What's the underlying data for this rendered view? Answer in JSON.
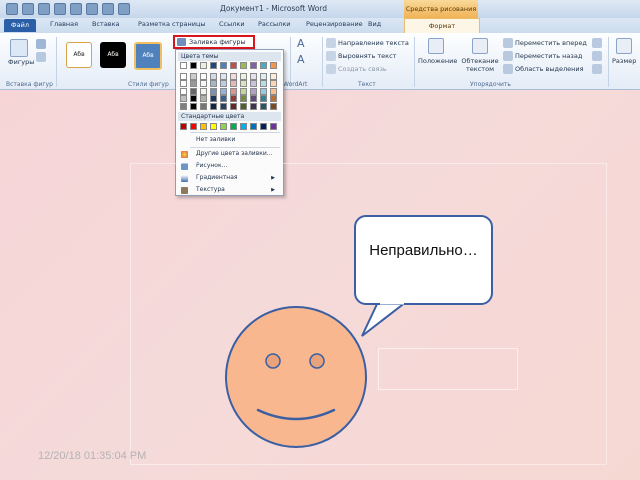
{
  "window": {
    "title": "Документ1 - Microsoft Word",
    "context_tab_header": "Средства рисования"
  },
  "tabs": [
    {
      "label": "Файл"
    },
    {
      "label": "Главная"
    },
    {
      "label": "Вставка"
    },
    {
      "label": "Разметка страницы"
    },
    {
      "label": "Ссылки"
    },
    {
      "label": "Рассылки"
    },
    {
      "label": "Рецензирование"
    },
    {
      "label": "Вид"
    },
    {
      "label": "Формат"
    }
  ],
  "ribbon": {
    "shapes_label": "Фигуры",
    "group_insert_shapes": "Вставка фигур",
    "group_shape_styles": "Стили фигур",
    "group_wordart": "WordArt",
    "group_text": "Текст",
    "group_arrange": "Упорядочить",
    "style_sample": "Абв",
    "fill_button": "Заливка фигуры",
    "text_direction": "Направление текста",
    "align_text": "Выровнять текст",
    "create_link": "Создать связь",
    "position": "Положение",
    "wrap_text": "Обтекание текстом",
    "bring_forward": "Переместить вперед",
    "send_backward": "Переместить назад",
    "selection_pane": "Область выделения",
    "size": "Размер",
    "accent_color": "#d9141d"
  },
  "fill_menu": {
    "theme_colors_label": "Цвета темы",
    "theme_colors": [
      "#ffffff",
      "#000000",
      "#eeece1",
      "#1f497d",
      "#4f81bd",
      "#c0504d",
      "#9bbb59",
      "#8064a2",
      "#4bacc6",
      "#f79646"
    ],
    "standard_colors_label": "Стандартные цвета",
    "standard_colors": [
      "#c00000",
      "#ff0000",
      "#ffc000",
      "#ffff00",
      "#92d050",
      "#00b050",
      "#00b0f0",
      "#0070c0",
      "#002060",
      "#7030a0"
    ],
    "no_fill": "Нет заливки",
    "more_colors": "Другие цвета заливки...",
    "picture": "Рисунок...",
    "gradient": "Градиентная",
    "texture": "Текстура"
  },
  "slide": {
    "bubble_text": "Неправильно…",
    "timestamp": "12/20/18 01:35:04 PM",
    "face_color": "#f8b78f",
    "outline_color": "#3a5fa3"
  }
}
